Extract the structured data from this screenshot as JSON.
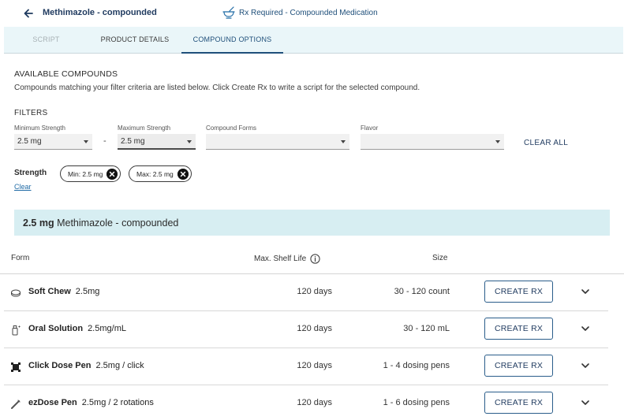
{
  "header": {
    "product_title": "Methimazole - compounded",
    "rx_label": "Rx Required - Compounded Medication"
  },
  "tabs": [
    {
      "label": "SCRIPT",
      "state": "disabled"
    },
    {
      "label": "PRODUCT DETAILS",
      "state": "normal"
    },
    {
      "label": "COMPOUND OPTIONS",
      "state": "active"
    }
  ],
  "available": {
    "heading": "AVAILABLE COMPOUNDS",
    "description": "Compounds matching your filter criteria are listed below. Click Create Rx to write a script for the selected compound."
  },
  "filters": {
    "heading": "FILTERS",
    "min_strength": {
      "label": "Minimum Strength",
      "value": "2.5 mg"
    },
    "separator": "-",
    "max_strength": {
      "label": "Maximum Strength",
      "value": "2.5 mg"
    },
    "compound_forms": {
      "label": "Compound Forms",
      "value": ""
    },
    "flavor": {
      "label": "Flavor",
      "value": ""
    },
    "clear_all": "CLEAR ALL"
  },
  "strength": {
    "label": "Strength",
    "clear": "Clear",
    "chips": [
      {
        "text": "Min: 2.5 mg"
      },
      {
        "text": "Max: 2.5 mg"
      }
    ]
  },
  "banner": {
    "strength": "2.5 mg",
    "name": "Methimazole - compounded"
  },
  "table": {
    "headers": {
      "form": "Form",
      "shelf_life": "Max. Shelf Life",
      "size": "Size"
    },
    "rows": [
      {
        "icon": "soft-chew-icon",
        "name": "Soft Chew",
        "strength": "2.5mg",
        "shelf_life": "120 days",
        "size": "30 - 120 count",
        "action": "CREATE RX"
      },
      {
        "icon": "bottle-icon",
        "name": "Oral Solution",
        "strength": "2.5mg/mL",
        "shelf_life": "120 days",
        "size": "30 - 120 mL",
        "action": "CREATE RX"
      },
      {
        "icon": "dose-pen-icon",
        "name": "Click Dose Pen",
        "strength": "2.5mg / click",
        "shelf_life": "120 days",
        "size": "1 - 4 dosing pens",
        "action": "CREATE RX"
      },
      {
        "icon": "pen-icon",
        "name": "ezDose Pen",
        "strength": "2.5mg / 2 rotations",
        "shelf_life": "120 days",
        "size": "1 - 6 dosing pens",
        "action": "CREATE RX"
      }
    ]
  },
  "colors": {
    "accent": "#1f3a5f",
    "tabbar_bg": "#eaf6f9",
    "banner_bg": "#d7eef2"
  }
}
